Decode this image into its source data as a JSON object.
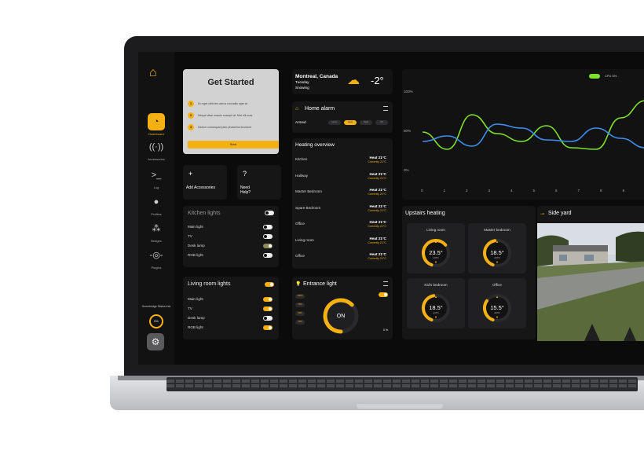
{
  "sidebar": {
    "items": [
      {
        "label": "Dashboard",
        "icon": "speedometer-icon"
      },
      {
        "label": "Accessories",
        "icon": "signal-icon"
      },
      {
        "label": "Log",
        "icon": "terminal-icon"
      },
      {
        "label": "Profiles",
        "icon": "user-icon"
      },
      {
        "label": "Bridges",
        "icon": "bridge-icon"
      },
      {
        "label": "Plugins",
        "icon": "plugin-icon"
      }
    ],
    "homebridge_label": "Homebridge\nStatus Info",
    "homebridge_value": "0%"
  },
  "get_started": {
    "title": "Get Started",
    "steps": [
      "Eu eget ultricies varius convallis eget at",
      "Neque vitae mauris suscipit at. Nisl elit cras",
      "Dictum consequat justo phasellus tincidunt"
    ],
    "start_label": "Start"
  },
  "mini_cards": [
    {
      "icon": "+",
      "label": "Add Accessories"
    },
    {
      "icon": "?",
      "label": "Need Help?"
    }
  ],
  "kitchen_lights": {
    "title": "Kitchen lights",
    "rows": [
      {
        "label": "Main light",
        "state": "off"
      },
      {
        "label": "TV",
        "state": "off"
      },
      {
        "label": "Desk lamp",
        "state": "dim"
      },
      {
        "label": "RGB light",
        "state": "off"
      }
    ]
  },
  "living_lights": {
    "title": "Living room lights",
    "rows": [
      {
        "label": "Main light",
        "state": "on"
      },
      {
        "label": "TV",
        "state": "on"
      },
      {
        "label": "Desk lamp",
        "state": "off"
      },
      {
        "label": "RGB light",
        "state": "on"
      }
    ]
  },
  "weather": {
    "city": "Montreal, Canada",
    "day": "Tuesday",
    "condition": "Snowing",
    "temp": "-2°",
    "icon": "snow-cloud-icon"
  },
  "alarm": {
    "title": "Home alarm",
    "state": "Armed",
    "options": [
      "Home",
      "Away",
      "Night",
      "Off"
    ],
    "selected_index": 1
  },
  "heating": {
    "title": "Heating overview",
    "rows": [
      {
        "room": "Kitchen",
        "set": "Heat 21°C",
        "current": "Currently 21°C"
      },
      {
        "room": "Hallway",
        "set": "Heat 21°C",
        "current": "Currently 21°C"
      },
      {
        "room": "Master Bedroom",
        "set": "Heat 21°C",
        "current": "Currently 21°C"
      },
      {
        "room": "Spare Bedroom",
        "set": "Heat 21°C",
        "current": "Currently 21°C"
      },
      {
        "room": "Office",
        "set": "Heat 21°C",
        "current": "Currently 21°C"
      },
      {
        "room": "Living room",
        "set": "Heat 21°C",
        "current": "Currently 21°C"
      },
      {
        "room": "Office",
        "set": "Heat 21°C",
        "current": "Currently 21°C"
      }
    ]
  },
  "entrance": {
    "title": "Entrance light",
    "state": "ON",
    "levels": [
      "100%",
      "75%",
      "50%",
      "25%"
    ],
    "footer": "0 %",
    "ring_fraction": 0.75
  },
  "upstairs": {
    "title": "Upstairs heating",
    "rooms": [
      {
        "name": "Living room",
        "temp": "23.5°",
        "mode": "AUTO",
        "fraction": 0.7
      },
      {
        "name": "Master bedroom",
        "temp": "18.5°",
        "mode": "AUTO",
        "fraction": 0.5
      },
      {
        "name": "Kid's bedroom",
        "temp": "18.5°",
        "mode": "AUTO",
        "fraction": 0.5
      },
      {
        "name": "Office",
        "temp": "15.5°",
        "mode": "AUTO",
        "fraction": 0.35
      }
    ]
  },
  "side_yard": {
    "title": "Side yard"
  },
  "chart_data": {
    "type": "line",
    "legend": "CPU 5%",
    "yticks": [
      "100%",
      "50%",
      "0%"
    ],
    "x": [
      0,
      1,
      2,
      3,
      4,
      5,
      6,
      7,
      8,
      9
    ],
    "ylim": [
      0,
      100
    ],
    "series": [
      {
        "color": "#7ee12a",
        "values": [
          50,
          28,
          72,
          48,
          38,
          58,
          30,
          28,
          68,
          90
        ]
      },
      {
        "color": "#3f8ff0",
        "values": [
          38,
          45,
          32,
          60,
          55,
          40,
          38,
          55,
          42,
          30
        ]
      }
    ]
  }
}
